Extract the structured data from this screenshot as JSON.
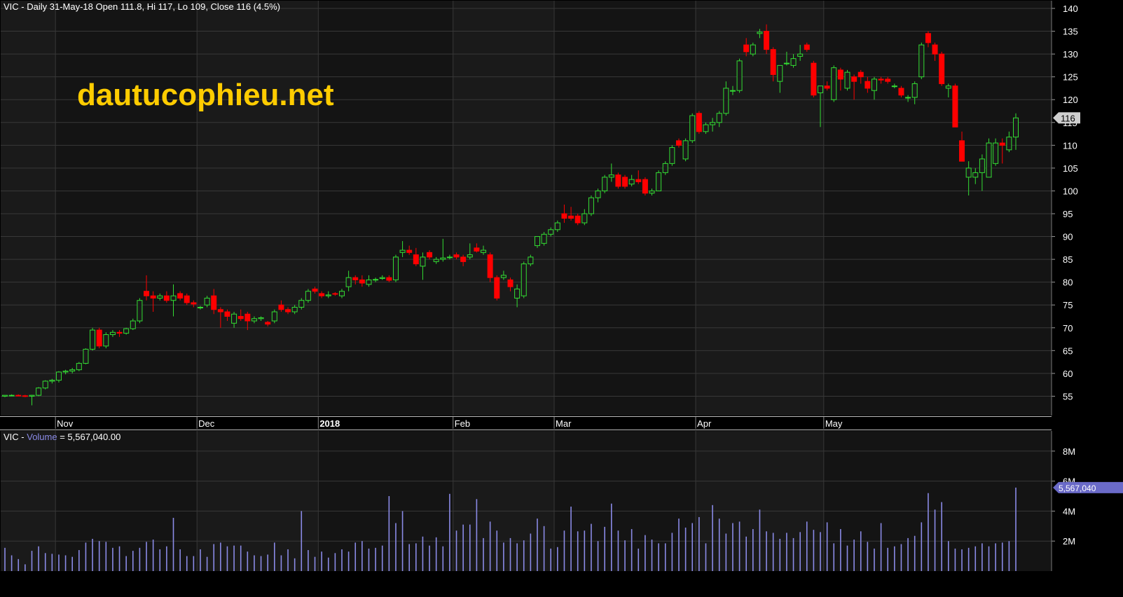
{
  "header": {
    "price_title": "VIC - Daily 31-May-18 Open 111.8, Hi 117, Lo 109, Close 116 (4.5%)",
    "watermark": "dautucophieu.net",
    "volume_prefix": "VIC - ",
    "volume_word": "Volume",
    "volume_suffix": " = 5,567,040.00"
  },
  "colors": {
    "background": "#000000",
    "price_panel": "#1a1a1a",
    "band_dark": "#141414",
    "grid": "#383838",
    "axis_text": "#ffffff",
    "up": "#33dd33",
    "down": "#ff0000",
    "volume_bar": "#8a8ae6",
    "volume_tag": "#6a6ac8",
    "price_tag": "#cfcfcf",
    "watermark": "#ffcc00",
    "volume_word": "#8a8ae6"
  },
  "chart_data": [
    {
      "type": "candlestick",
      "title": "VIC - Daily 31-May-18 Open 111.8, Hi 117, Lo 109, Close 116 (4.5%)",
      "ylim": [
        50,
        140
      ],
      "y_ticks": [
        55,
        60,
        65,
        70,
        75,
        80,
        85,
        90,
        95,
        100,
        105,
        110,
        115,
        120,
        125,
        130,
        135,
        140
      ],
      "x_ticks": [
        {
          "label": "Nov",
          "index": 8
        },
        {
          "label": "Dec",
          "index": 29
        },
        {
          "label": "2018",
          "index": 47
        },
        {
          "label": "Feb",
          "index": 67
        },
        {
          "label": "Mar",
          "index": 82
        },
        {
          "label": "Apr",
          "index": 103
        },
        {
          "label": "May",
          "index": 122
        }
      ],
      "grid": true,
      "last_price_label": "116",
      "candles": [
        [
          55.0,
          55.2,
          54.8,
          55.2
        ],
        [
          55.2,
          55.4,
          55.0,
          55.2
        ],
        [
          55.2,
          55.4,
          55.0,
          55.1
        ],
        [
          55.1,
          55.3,
          54.8,
          55.0
        ],
        [
          55.0,
          55.3,
          53.0,
          55.2
        ],
        [
          55.2,
          57.0,
          55.0,
          56.8
        ],
        [
          56.8,
          58.5,
          56.5,
          58.3
        ],
        [
          58.3,
          58.8,
          57.8,
          58.5
        ],
        [
          58.5,
          60.5,
          58.0,
          60.3
        ],
        [
          60.3,
          60.8,
          59.8,
          60.5
        ],
        [
          60.5,
          61.2,
          60.0,
          60.8
        ],
        [
          60.8,
          62.5,
          60.5,
          62.2
        ],
        [
          62.2,
          65.5,
          62.0,
          65.3
        ],
        [
          65.3,
          70.0,
          65.0,
          69.5
        ],
        [
          69.5,
          70.0,
          65.5,
          66.0
        ],
        [
          66.0,
          69.0,
          65.5,
          68.5
        ],
        [
          68.5,
          69.5,
          68.0,
          69.0
        ],
        [
          69.0,
          69.5,
          68.0,
          68.8
        ],
        [
          68.8,
          70.0,
          68.5,
          69.8
        ],
        [
          69.8,
          72.0,
          69.5,
          71.5
        ],
        [
          71.5,
          76.5,
          71.0,
          76.0
        ],
        [
          78.0,
          81.5,
          76.0,
          77.0
        ],
        [
          77.0,
          78.0,
          73.5,
          76.5
        ],
        [
          76.5,
          77.5,
          76.0,
          77.0
        ],
        [
          77.0,
          78.0,
          75.5,
          76.0
        ],
        [
          76.0,
          79.5,
          72.5,
          77.0
        ],
        [
          77.5,
          78.0,
          76.0,
          76.5
        ],
        [
          77.0,
          77.5,
          75.0,
          75.5
        ],
        [
          75.5,
          76.0,
          74.5,
          75.2
        ],
        [
          74.5,
          74.8,
          74.0,
          74.5
        ],
        [
          75.0,
          77.0,
          74.5,
          76.5
        ],
        [
          77.0,
          78.5,
          73.0,
          74.0
        ],
        [
          74.0,
          74.5,
          70.0,
          73.5
        ],
        [
          73.5,
          74.0,
          71.5,
          72.5
        ],
        [
          71.0,
          73.5,
          70.0,
          73.0
        ],
        [
          72.5,
          74.0,
          71.5,
          72.0
        ],
        [
          73.0,
          73.5,
          69.5,
          71.5
        ],
        [
          71.5,
          72.5,
          71.0,
          72.0
        ],
        [
          72.0,
          72.5,
          71.5,
          72.2
        ],
        [
          71.2,
          71.5,
          70.3,
          70.8
        ],
        [
          71.5,
          74.0,
          71.0,
          73.5
        ],
        [
          75.0,
          76.0,
          73.5,
          74.0
        ],
        [
          74.0,
          74.5,
          73.0,
          73.5
        ],
        [
          73.5,
          75.0,
          73.0,
          74.5
        ],
        [
          74.5,
          76.5,
          74.0,
          76.0
        ],
        [
          76.0,
          78.5,
          75.5,
          78.0
        ],
        [
          78.5,
          79.0,
          77.5,
          78.0
        ],
        [
          77.5,
          78.0,
          76.5,
          77.0
        ],
        [
          77.0,
          78.0,
          76.5,
          77.2
        ],
        [
          77.5,
          77.8,
          77.0,
          77.4
        ],
        [
          77.0,
          78.5,
          76.5,
          78.0
        ],
        [
          79.0,
          82.5,
          78.0,
          81.0
        ],
        [
          81.0,
          81.5,
          79.5,
          80.5
        ],
        [
          80.5,
          81.5,
          79.0,
          79.8
        ],
        [
          79.5,
          81.5,
          79.0,
          80.5
        ],
        [
          80.5,
          81.0,
          80.0,
          80.6
        ],
        [
          80.8,
          81.5,
          80.5,
          81.0
        ],
        [
          81.0,
          81.5,
          80.0,
          80.4
        ],
        [
          80.5,
          86.0,
          80.0,
          85.5
        ],
        [
          86.5,
          89.0,
          85.5,
          87.0
        ],
        [
          87.0,
          88.0,
          86.0,
          86.5
        ],
        [
          86.0,
          87.5,
          83.5,
          84.0
        ],
        [
          83.5,
          86.5,
          80.5,
          85.5
        ],
        [
          86.5,
          87.0,
          85.0,
          85.5
        ],
        [
          84.5,
          85.5,
          84.0,
          85.0
        ],
        [
          85.0,
          89.5,
          84.5,
          85.3
        ],
        [
          85.5,
          86.0,
          85.0,
          85.5
        ],
        [
          86.0,
          86.5,
          85.0,
          85.5
        ],
        [
          85.5,
          86.0,
          83.5,
          84.5
        ],
        [
          85.5,
          88.5,
          85.0,
          86.0
        ],
        [
          87.5,
          88.5,
          86.5,
          86.8
        ],
        [
          86.5,
          88.0,
          86.0,
          87.0
        ],
        [
          86.0,
          86.5,
          80.0,
          81.0
        ],
        [
          81.0,
          81.5,
          76.0,
          76.5
        ],
        [
          81.0,
          82.5,
          80.5,
          81.5
        ],
        [
          80.5,
          81.0,
          78.0,
          79.0
        ],
        [
          76.5,
          79.5,
          74.5,
          78.5
        ],
        [
          77.0,
          84.5,
          76.5,
          84.0
        ],
        [
          84.0,
          86.0,
          83.5,
          85.5
        ],
        [
          88.0,
          90.0,
          87.5,
          90.0
        ],
        [
          88.5,
          91.0,
          88.0,
          90.5
        ],
        [
          90.5,
          92.0,
          90.0,
          91.5
        ],
        [
          91.5,
          93.5,
          91.0,
          93.0
        ],
        [
          95.0,
          97.0,
          93.0,
          94.0
        ],
        [
          94.5,
          96.5,
          93.5,
          94.0
        ],
        [
          94.5,
          95.0,
          92.5,
          93.0
        ],
        [
          93.0,
          96.0,
          92.5,
          95.0
        ],
        [
          95.0,
          99.0,
          94.5,
          98.5
        ],
        [
          98.5,
          100.5,
          97.5,
          100.0
        ],
        [
          100.0,
          103.5,
          99.5,
          103.0
        ],
        [
          103.0,
          106.0,
          102.0,
          103.5
        ],
        [
          103.5,
          104.0,
          100.5,
          101.0
        ],
        [
          103.0,
          103.5,
          100.5,
          101.0
        ],
        [
          101.5,
          103.5,
          101.0,
          102.5
        ],
        [
          102.5,
          104.5,
          101.5,
          102.0
        ],
        [
          102.5,
          103.0,
          99.0,
          99.5
        ],
        [
          99.5,
          100.5,
          99.0,
          100.0
        ],
        [
          100.0,
          104.5,
          100.0,
          104.0
        ],
        [
          104.0,
          106.5,
          103.5,
          106.0
        ],
        [
          106.0,
          110.0,
          105.5,
          109.5
        ],
        [
          111.0,
          111.5,
          109.5,
          110.0
        ],
        [
          107.0,
          111.5,
          106.5,
          111.0
        ],
        [
          111.0,
          117.0,
          110.5,
          116.5
        ],
        [
          117.0,
          117.5,
          112.5,
          113.0
        ],
        [
          113.0,
          115.0,
          112.5,
          114.5
        ],
        [
          114.5,
          116.0,
          113.0,
          115.0
        ],
        [
          115.0,
          117.5,
          114.0,
          117.0
        ],
        [
          117.0,
          124.0,
          116.5,
          122.5
        ],
        [
          122.0,
          123.0,
          121.0,
          122.0
        ],
        [
          122.0,
          129.0,
          121.5,
          128.5
        ],
        [
          132.0,
          133.5,
          129.5,
          130.5
        ],
        [
          130.0,
          132.5,
          129.5,
          132.0
        ],
        [
          134.5,
          135.5,
          133.5,
          134.8
        ],
        [
          135.0,
          136.5,
          130.0,
          131.0
        ],
        [
          131.0,
          131.5,
          124.0,
          125.5
        ],
        [
          124.0,
          127.5,
          121.5,
          127.5
        ],
        [
          128.0,
          130.5,
          127.5,
          128.0
        ],
        [
          127.5,
          130.0,
          127.0,
          129.0
        ],
        [
          129.5,
          132.0,
          128.5,
          130.0
        ],
        [
          132.0,
          132.5,
          130.5,
          131.0
        ],
        [
          128.0,
          128.5,
          120.5,
          121.0
        ],
        [
          121.5,
          123.0,
          114.0,
          123.0
        ],
        [
          123.0,
          124.0,
          122.0,
          122.5
        ],
        [
          120.0,
          127.5,
          119.5,
          127.0
        ],
        [
          126.5,
          127.0,
          122.0,
          124.5
        ],
        [
          122.5,
          126.5,
          122.0,
          126.0
        ],
        [
          125.0,
          125.5,
          120.0,
          124.0
        ],
        [
          126.0,
          126.5,
          123.5,
          125.0
        ],
        [
          124.0,
          125.0,
          121.5,
          122.5
        ],
        [
          122.0,
          125.0,
          120.0,
          124.5
        ],
        [
          124.5,
          125.0,
          123.5,
          124.3
        ],
        [
          124.5,
          125.0,
          123.5,
          124.0
        ],
        [
          123.0,
          123.5,
          122.5,
          123.0
        ],
        [
          122.5,
          123.0,
          120.5,
          121.0
        ],
        [
          120.5,
          121.0,
          119.5,
          120.5
        ],
        [
          120.5,
          124.0,
          119.0,
          123.5
        ],
        [
          125.0,
          132.5,
          124.5,
          132.0
        ],
        [
          134.5,
          135.0,
          131.5,
          132.5
        ],
        [
          132.0,
          132.5,
          128.5,
          130.0
        ],
        [
          130.0,
          130.5,
          123.0,
          123.5
        ],
        [
          122.5,
          123.5,
          120.5,
          123.0
        ],
        [
          123.0,
          123.5,
          114.0,
          114.0
        ],
        [
          111.0,
          113.0,
          106.5,
          106.5
        ],
        [
          103.0,
          106.5,
          99.0,
          105.0
        ],
        [
          103.0,
          105.0,
          101.5,
          104.0
        ],
        [
          104.0,
          108.0,
          100.0,
          107.0
        ],
        [
          103.0,
          111.5,
          103.0,
          110.5
        ],
        [
          106.0,
          111.5,
          105.5,
          110.5
        ],
        [
          110.5,
          111.5,
          106.0,
          110.0
        ],
        [
          109.0,
          113.0,
          108.5,
          111.8
        ],
        [
          111.8,
          117.0,
          109.0,
          116.0
        ]
      ]
    },
    {
      "type": "bar",
      "title": "VIC - Volume = 5,567,040.00",
      "ylim": [
        0,
        10000000
      ],
      "y_ticks": [
        {
          "value": 2000000,
          "label": "2M"
        },
        {
          "value": 4000000,
          "label": "4M"
        },
        {
          "value": 6000000,
          "label": "6M"
        },
        {
          "value": 8000000,
          "label": "8M"
        }
      ],
      "last_value_label": "5,567,040",
      "values": [
        1550000,
        1050000,
        800000,
        450000,
        1350000,
        1650000,
        1200000,
        1150000,
        1100000,
        1050000,
        950000,
        1400000,
        1900000,
        2150000,
        2000000,
        1950000,
        1550000,
        1650000,
        1000000,
        1350000,
        1550000,
        1950000,
        2100000,
        1450000,
        1650000,
        3550000,
        1450000,
        1000000,
        1000000,
        1450000,
        950000,
        1800000,
        1900000,
        1650000,
        1700000,
        1700000,
        1300000,
        1050000,
        1000000,
        1100000,
        1900000,
        1050000,
        1450000,
        850000,
        4000000,
        1400000,
        950000,
        1300000,
        900000,
        1200000,
        1450000,
        1300000,
        1900000,
        2000000,
        1500000,
        1550000,
        1700000,
        5000000,
        3200000,
        4000000,
        1800000,
        1850000,
        2300000,
        1700000,
        2250000,
        1650000,
        5150000,
        2700000,
        3100000,
        3100000,
        4800000,
        2200000,
        3300000,
        2700000,
        1900000,
        2200000,
        1850000,
        2050000,
        2500000,
        3500000,
        3000000,
        1500000,
        1600000,
        2700000,
        4300000,
        2650000,
        2700000,
        3150000,
        2000000,
        2950000,
        4500000,
        2700000,
        2050000,
        2800000,
        1500000,
        2400000,
        2100000,
        1850000,
        1850000,
        2550000,
        3500000,
        2900000,
        3200000,
        3600000,
        1850000,
        4400000,
        3500000,
        2500000,
        3200000,
        3300000,
        2300000,
        2800000,
        4100000,
        2650000,
        2550000,
        2150000,
        2550000,
        2200000,
        2600000,
        3300000,
        2750000,
        2600000,
        3250000,
        1850000,
        2800000,
        1700000,
        2100000,
        2650000,
        1950000,
        1500000,
        3200000,
        1550000,
        1650000,
        1800000,
        2200000,
        2350000,
        3250000,
        5200000,
        4100000,
        4600000,
        2000000,
        1500000,
        1450000,
        1550000,
        1650000,
        1850000,
        1650000,
        1850000,
        1900000,
        2000000,
        5567040
      ]
    }
  ]
}
